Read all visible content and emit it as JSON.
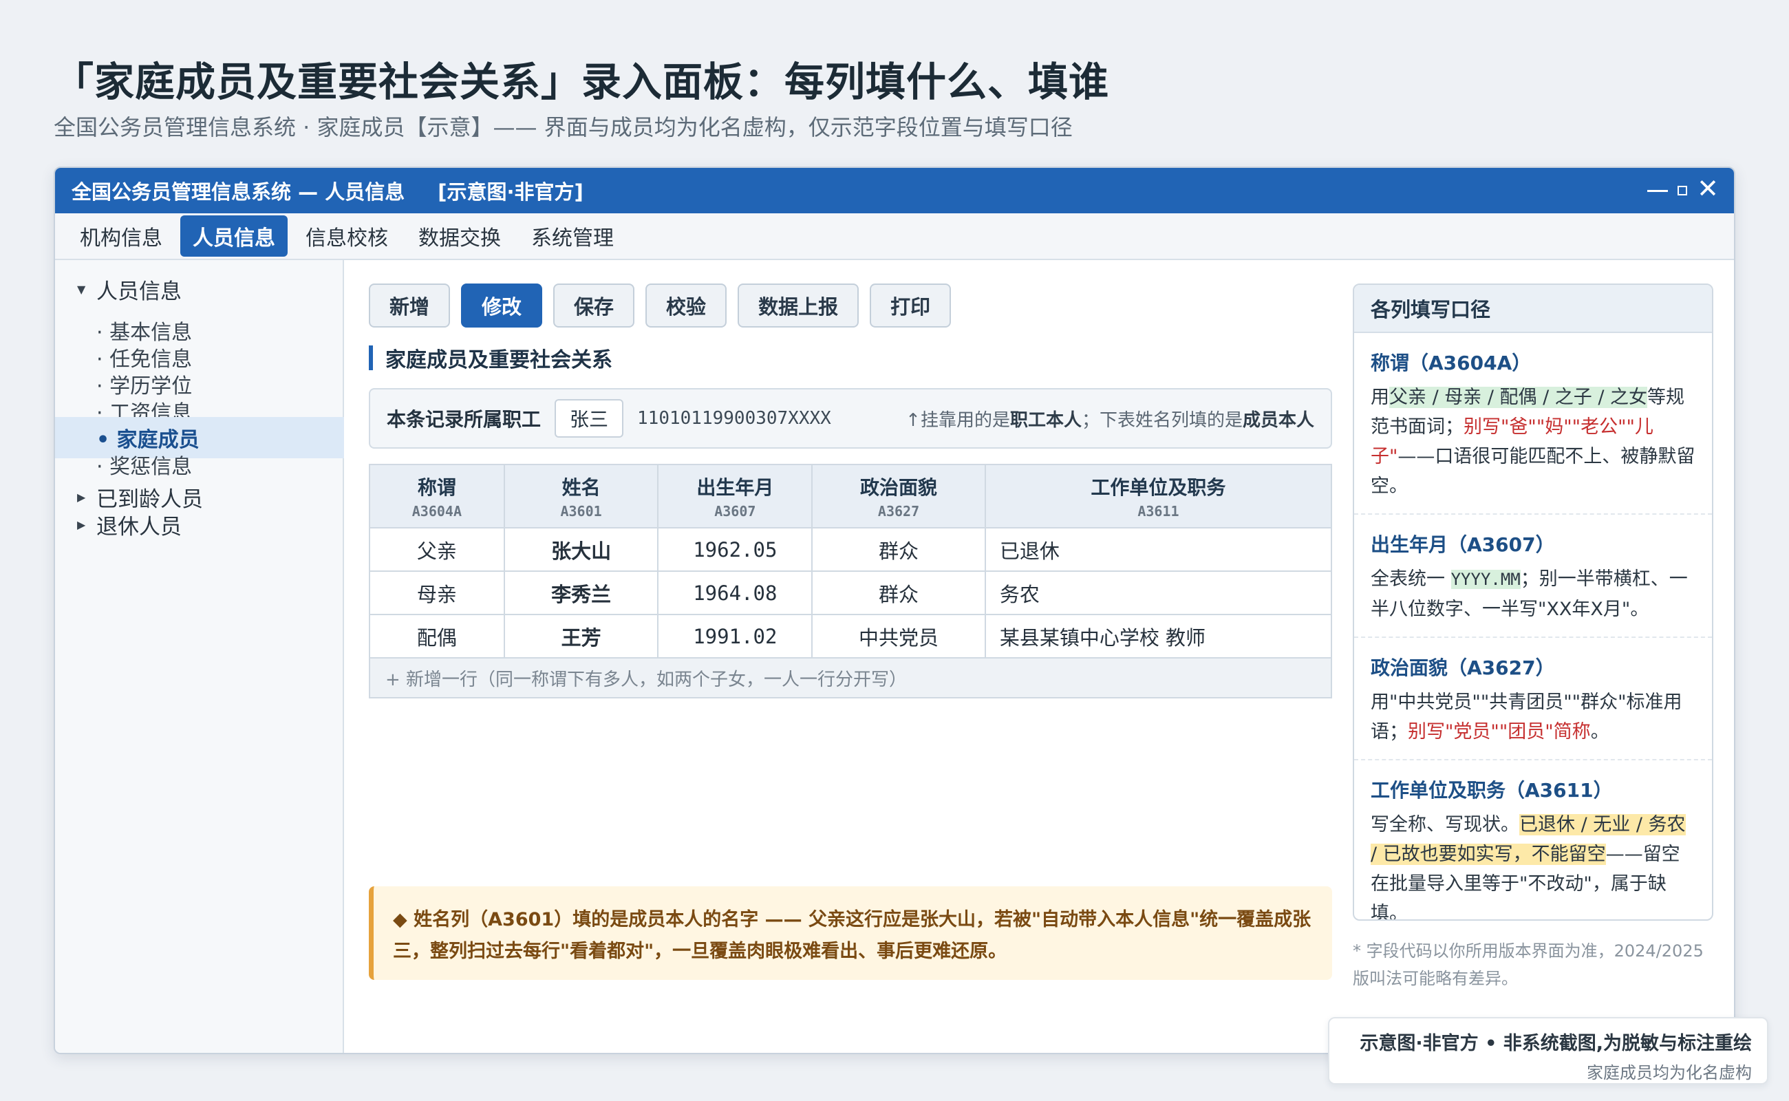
{
  "header": {
    "title": "「家庭成员及重要社会关系」录入面板：每列填什么、填谁",
    "subtitle": "全国公务员管理信息系统 · 家庭成员【示意】—— 界面与成员均为化名虚构，仅示范字段位置与填写口径"
  },
  "window": {
    "title": "全国公务员管理信息系统 — 人员信息",
    "badge": "[示意图·非官方]"
  },
  "menu": [
    "机构信息",
    "人员信息",
    "信息校核",
    "数据交换",
    "系统管理"
  ],
  "sidebar": {
    "root_expanded": "人员信息",
    "children": [
      "· 基本信息",
      "· 任免信息",
      "· 学历学位",
      "· 工资信息",
      "• 家庭成员",
      "· 奖惩信息"
    ],
    "root_collapsed_1": "已到龄人员",
    "root_collapsed_2": "退休人员"
  },
  "toolbar": [
    "新增",
    "修改",
    "保存",
    "校验",
    "数据上报",
    "打印"
  ],
  "section_title": "家庭成员及重要社会关系",
  "owner": {
    "label": "本条记录所属职工",
    "name": "张三",
    "id_number": "11010119900307XXXX",
    "hint_prefix": "↑挂靠用的是",
    "hint_b1": "职工本人",
    "hint_mid": "；下表姓名列填的是",
    "hint_b2": "成员本人"
  },
  "table": {
    "columns": [
      {
        "label": "称谓",
        "code": "A3604A"
      },
      {
        "label": "姓名",
        "code": "A3601"
      },
      {
        "label": "出生年月",
        "code": "A3607"
      },
      {
        "label": "政治面貌",
        "code": "A3627"
      },
      {
        "label": "工作单位及职务",
        "code": "A3611"
      }
    ],
    "rows": [
      [
        "父亲",
        "张大山",
        "1962.05",
        "群众",
        "已退休"
      ],
      [
        "母亲",
        "李秀兰",
        "1964.08",
        "群众",
        "务农"
      ],
      [
        "配偶",
        "王芳",
        "1991.02",
        "中共党员",
        "某县某镇中心学校 教师"
      ]
    ],
    "add_row": "+ 新增一行（同一称谓下有多人，如两个子女，一人一行分开写）"
  },
  "warning": "◆ 姓名列（A3601）填的是成员本人的名字 —— 父亲这行应是张大山，若被\"自动带入本人信息\"统一覆盖成张三，整列扫过去每行\"看着都对\"，一旦覆盖肉眼极难看出、事后更难还原。",
  "guide": {
    "title": "各列填写口径",
    "items": {
      "relation": {
        "title": "称谓（A3604A）",
        "t1": "用",
        "hl": "父亲 / 母亲 / 配偶 / 之子 / 之女",
        "t2": "等规范书面词；",
        "red": "别写\"爸\"\"妈\"\"老公\"\"儿子\"",
        "t3": "——口语很可能匹配不上、被静默留空。"
      },
      "birth": {
        "title": "出生年月（A3607）",
        "t1": "全表统一 ",
        "code": "YYYY.MM",
        "t2": "；别一半带横杠、一半八位数字、一半写\"XX年X月\"。"
      },
      "politics": {
        "title": "政治面貌（A3627）",
        "t1": "用\"中共党员\"\"共青团员\"\"群众\"标准用语；",
        "red": "别写\"党员\"\"团员\"简称",
        "t2": "。"
      },
      "work": {
        "title": "工作单位及职务（A3611）",
        "t1": "写全称、写现状。",
        "hl": "已退休 / 无业 / 务农 / 已故也要如实写，不能留空",
        "t2": "——留空在批量导入里等于\"不改动\"，属于缺填。"
      }
    }
  },
  "footnote": "* 字段代码以你所用版本界面为准，2024/2025 版叫法可能略有差异。",
  "stamp": {
    "line1": "示意图·非官方 • 非系统截图,为脱敏与标注重绘",
    "line2": "家庭成员均为化名虚构"
  }
}
